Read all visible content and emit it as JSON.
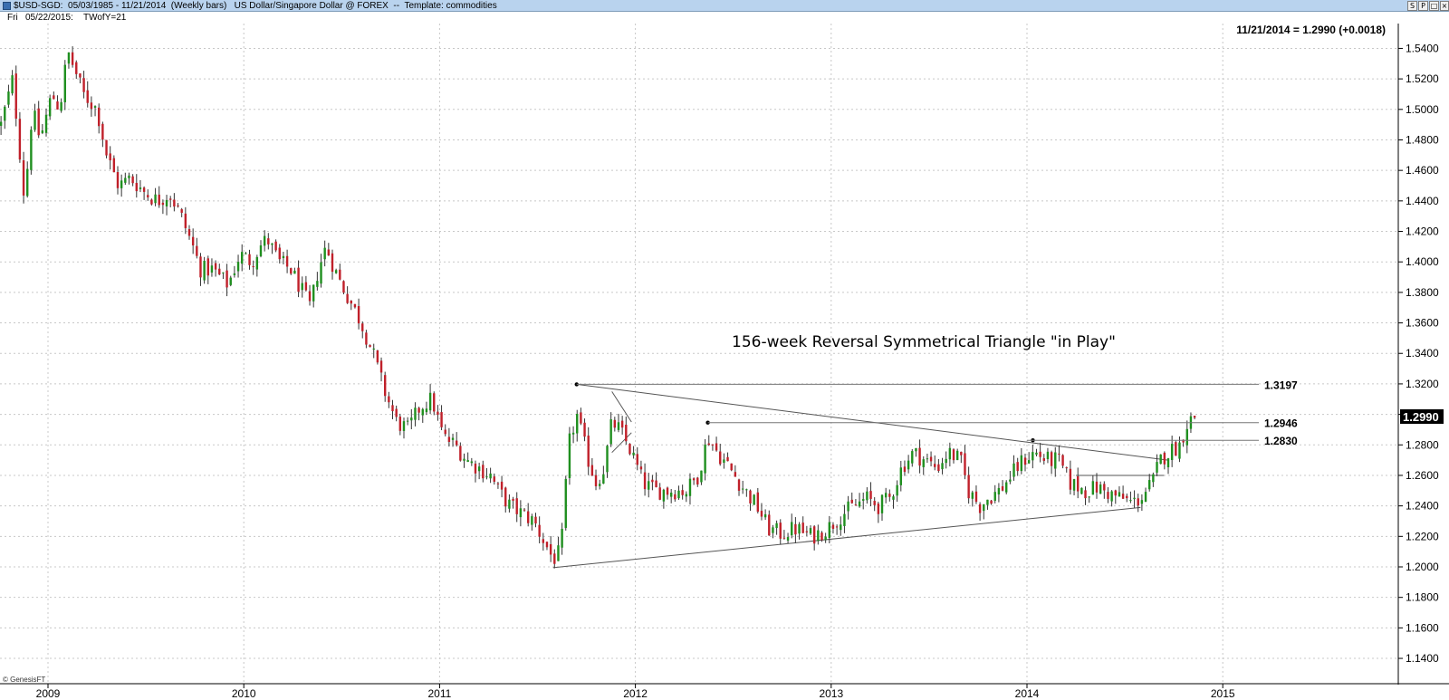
{
  "window": {
    "title": "$USD-SGD:  05/03/1985 - 11/21/2014  (Weekly bars)   US Dollar/Singapore Dollar @ FOREX  --  Template: commodities",
    "buttons": [
      "S",
      "P",
      "□",
      "×"
    ]
  },
  "infobar": {
    "day": "Fri",
    "date": "05/22/2015:",
    "indicator": "TWofY=21"
  },
  "chart_data": {
    "type": "candlestick",
    "title": "156-week Reversal Symmetrical Triangle \"in Play\"",
    "header_value": "11/21/2014 = 1.2990 (+0.0018)",
    "last_price": "1.2990",
    "copyright": "© GenesisFT",
    "ylim": [
      1.13,
      1.558
    ],
    "y_ticks": [
      "1.5400",
      "1.5200",
      "1.5000",
      "1.4800",
      "1.4600",
      "1.4400",
      "1.4200",
      "1.4000",
      "1.3800",
      "1.3600",
      "1.3400",
      "1.3200",
      "1.3000",
      "1.2800",
      "1.2600",
      "1.2400",
      "1.2200",
      "1.2000",
      "1.1800",
      "1.1600",
      "1.1400"
    ],
    "x_ticks": [
      "2009",
      "2010",
      "2011",
      "2012",
      "2013",
      "2014",
      "2015"
    ],
    "x_tick_years": [
      2009.0,
      2010.0,
      2011.0,
      2012.0,
      2013.0,
      2014.0,
      2015.0
    ],
    "x_range": [
      2008.76,
      2015.7
    ],
    "levels": [
      {
        "label": "1.3197",
        "value": 1.3197,
        "from": 2011.7
      },
      {
        "label": "1.2946",
        "value": 1.2946,
        "from": 2012.37
      },
      {
        "label": "1.2830",
        "value": 1.283,
        "from": 2014.0
      }
    ],
    "trendlines": [
      {
        "name": "upper",
        "points": [
          [
            2011.7,
            1.3197
          ],
          [
            2014.72,
            1.27
          ]
        ]
      },
      {
        "name": "lower",
        "points": [
          [
            2011.58,
            1.1995
          ],
          [
            2014.58,
            1.239
          ]
        ]
      },
      {
        "name": "inner-resistance",
        "points": [
          [
            2014.25,
            1.26
          ],
          [
            2014.7,
            1.26
          ]
        ]
      },
      {
        "name": "pennant-top",
        "points": [
          [
            2011.88,
            1.315
          ],
          [
            2011.98,
            1.295
          ]
        ]
      },
      {
        "name": "pennant-bottom",
        "points": [
          [
            2011.88,
            1.275
          ],
          [
            2011.98,
            1.288
          ]
        ]
      }
    ],
    "markers": [
      [
        2011.7,
        1.3197
      ],
      [
        2012.37,
        1.2946
      ],
      [
        2014.03,
        1.283
      ]
    ],
    "close_path": [
      [
        2008.76,
        1.49
      ],
      [
        2008.82,
        1.52
      ],
      [
        2008.88,
        1.44
      ],
      [
        2008.92,
        1.5
      ],
      [
        2008.96,
        1.48
      ],
      [
        2009.02,
        1.51
      ],
      [
        2009.06,
        1.5
      ],
      [
        2009.1,
        1.538
      ],
      [
        2009.14,
        1.525
      ],
      [
        2009.18,
        1.51
      ],
      [
        2009.25,
        1.5
      ],
      [
        2009.3,
        1.47
      ],
      [
        2009.36,
        1.45
      ],
      [
        2009.42,
        1.455
      ],
      [
        2009.5,
        1.445
      ],
      [
        2009.56,
        1.44
      ],
      [
        2009.62,
        1.445
      ],
      [
        2009.68,
        1.43
      ],
      [
        2009.74,
        1.41
      ],
      [
        2009.78,
        1.395
      ],
      [
        2009.84,
        1.395
      ],
      [
        2009.92,
        1.385
      ],
      [
        2009.98,
        1.405
      ],
      [
        2010.04,
        1.4
      ],
      [
        2010.08,
        1.41
      ],
      [
        2010.12,
        1.415
      ],
      [
        2010.18,
        1.4
      ],
      [
        2010.24,
        1.395
      ],
      [
        2010.3,
        1.38
      ],
      [
        2010.34,
        1.37
      ],
      [
        2010.38,
        1.395
      ],
      [
        2010.42,
        1.41
      ],
      [
        2010.48,
        1.39
      ],
      [
        2010.54,
        1.375
      ],
      [
        2010.6,
        1.36
      ],
      [
        2010.66,
        1.34
      ],
      [
        2010.72,
        1.315
      ],
      [
        2010.78,
        1.295
      ],
      [
        2010.84,
        1.29
      ],
      [
        2010.9,
        1.305
      ],
      [
        2010.96,
        1.31
      ],
      [
        2011.02,
        1.285
      ],
      [
        2011.08,
        1.28
      ],
      [
        2011.14,
        1.27
      ],
      [
        2011.2,
        1.265
      ],
      [
        2011.26,
        1.26
      ],
      [
        2011.3,
        1.25
      ],
      [
        2011.36,
        1.24
      ],
      [
        2011.42,
        1.235
      ],
      [
        2011.48,
        1.23
      ],
      [
        2011.54,
        1.215
      ],
      [
        2011.58,
        1.205
      ],
      [
        2011.62,
        1.21
      ],
      [
        2011.66,
        1.28
      ],
      [
        2011.7,
        1.3
      ],
      [
        2011.76,
        1.27
      ],
      [
        2011.8,
        1.255
      ],
      [
        2011.84,
        1.265
      ],
      [
        2011.88,
        1.295
      ],
      [
        2011.92,
        1.29
      ],
      [
        2011.98,
        1.275
      ],
      [
        2012.04,
        1.255
      ],
      [
        2012.1,
        1.25
      ],
      [
        2012.18,
        1.25
      ],
      [
        2012.26,
        1.25
      ],
      [
        2012.32,
        1.26
      ],
      [
        2012.37,
        1.285
      ],
      [
        2012.42,
        1.275
      ],
      [
        2012.48,
        1.265
      ],
      [
        2012.56,
        1.25
      ],
      [
        2012.62,
        1.24
      ],
      [
        2012.68,
        1.225
      ],
      [
        2012.74,
        1.222
      ],
      [
        2012.82,
        1.225
      ],
      [
        2012.9,
        1.22
      ],
      [
        2012.98,
        1.225
      ],
      [
        2013.06,
        1.235
      ],
      [
        2013.12,
        1.24
      ],
      [
        2013.18,
        1.245
      ],
      [
        2013.24,
        1.24
      ],
      [
        2013.3,
        1.245
      ],
      [
        2013.36,
        1.265
      ],
      [
        2013.42,
        1.275
      ],
      [
        2013.48,
        1.27
      ],
      [
        2013.54,
        1.265
      ],
      [
        2013.6,
        1.275
      ],
      [
        2013.66,
        1.27
      ],
      [
        2013.7,
        1.25
      ],
      [
        2013.76,
        1.24
      ],
      [
        2013.8,
        1.245
      ],
      [
        2013.86,
        1.25
      ],
      [
        2013.92,
        1.26
      ],
      [
        2013.98,
        1.27
      ],
      [
        2014.04,
        1.275
      ],
      [
        2014.1,
        1.27
      ],
      [
        2014.16,
        1.27
      ],
      [
        2014.22,
        1.255
      ],
      [
        2014.3,
        1.25
      ],
      [
        2014.36,
        1.252
      ],
      [
        2014.42,
        1.248
      ],
      [
        2014.48,
        1.245
      ],
      [
        2014.54,
        1.242
      ],
      [
        2014.58,
        1.245
      ],
      [
        2014.64,
        1.255
      ],
      [
        2014.68,
        1.27
      ],
      [
        2014.72,
        1.275
      ],
      [
        2014.78,
        1.28
      ],
      [
        2014.82,
        1.295
      ],
      [
        2014.86,
        1.299
      ]
    ]
  }
}
